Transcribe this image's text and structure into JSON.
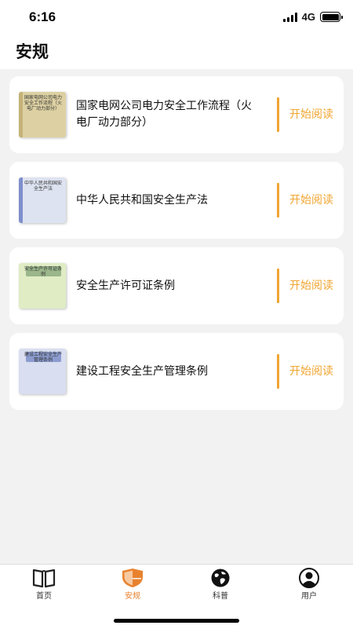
{
  "status_bar": {
    "time": "6:16",
    "network": "4G",
    "battery_level": 1.0
  },
  "header": {
    "title": "安规"
  },
  "items": [
    {
      "title": "国家电网公司电力安全工作流程（火电厂动力部分）",
      "cover_text": "国家电网公司电力安全工作流程（火电厂动力部分）",
      "cover_color": "#ddd1a3",
      "accent_color": "#c4b277",
      "action_label": "开始阅读"
    },
    {
      "title": "中华人民共和国安全生产法",
      "cover_text": "中华人民共和国安全生产法",
      "cover_color": "#dde3f0",
      "accent_color": "#7f8fcc",
      "action_label": "开始阅读"
    },
    {
      "title": "安全生产许可证条例",
      "cover_text": "安全生产许可证条例",
      "cover_color": "#dfecc4",
      "accent_color": "#9ab68a",
      "action_label": "开始阅读"
    },
    {
      "title": "建设工程安全生产管理条例",
      "cover_text": "建设工程安全生产管理条例",
      "cover_color": "#d9def0",
      "accent_color": "#8c9ccf",
      "action_label": "开始阅读"
    }
  ],
  "tabbar": {
    "tabs": [
      {
        "label": "首页",
        "icon": "book-open-icon",
        "active": false
      },
      {
        "label": "安规",
        "icon": "shield-icon",
        "active": true
      },
      {
        "label": "科普",
        "icon": "globe-icon",
        "active": false
      },
      {
        "label": "用户",
        "icon": "user-icon",
        "active": false
      }
    ],
    "active_color": "#e8822e"
  },
  "colors": {
    "accent": "#f0a531",
    "background": "#f2f2f2"
  }
}
